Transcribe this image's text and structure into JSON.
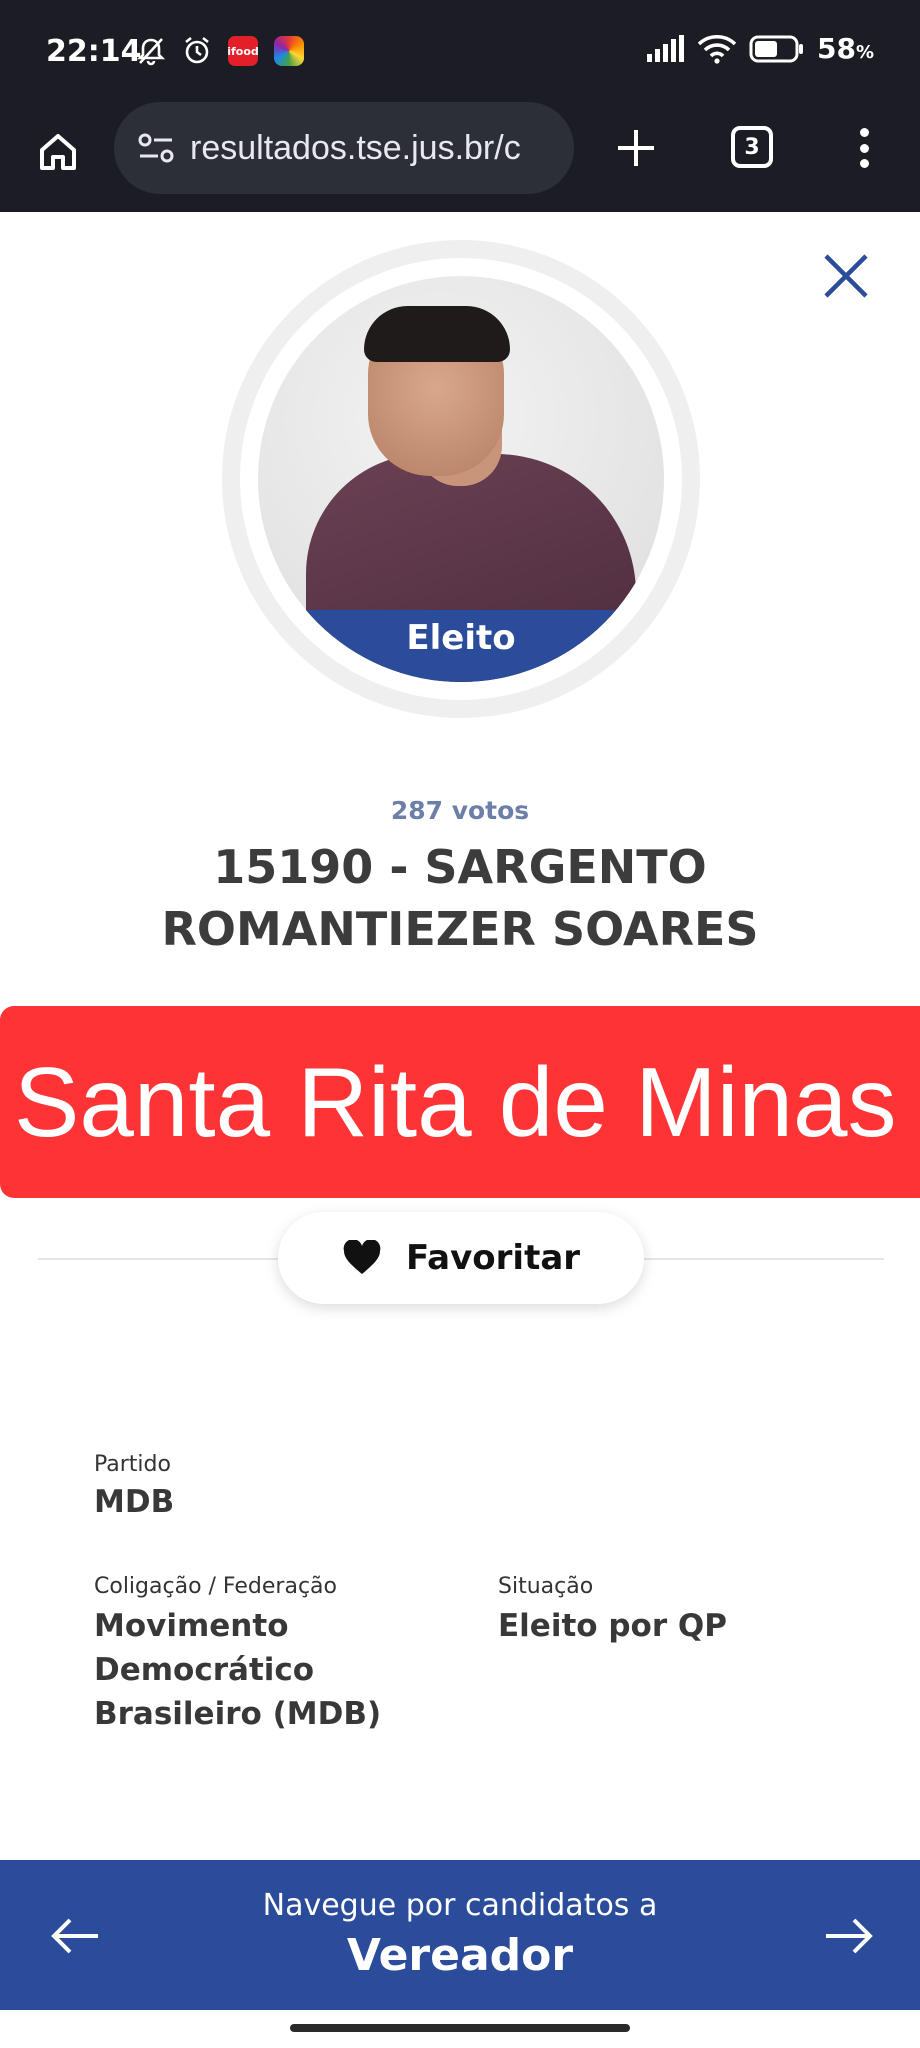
{
  "status_bar": {
    "time": "22:14",
    "left_icons": [
      "notifications-muted-icon",
      "alarm-icon",
      "ifood-app-icon",
      "colorful-app-icon"
    ],
    "ifood_text": "ifood",
    "right_icons": [
      "signal-icon",
      "wifi-icon",
      "battery-icon"
    ],
    "battery_percent": "58",
    "battery_unit": "%",
    "battery_level": 0.58
  },
  "browser": {
    "url": "resultados.tse.jus.br/c",
    "tab_count": "3",
    "icons": [
      "home-icon",
      "site-settings-icon",
      "new-tab-icon",
      "tabs-icon",
      "more-menu-icon"
    ]
  },
  "candidate": {
    "status_badge": "Eleito",
    "votes": "287 votos",
    "name_line1": "15190 - SARGENTO",
    "name_line2": "ROMANTIEZER SOARES"
  },
  "overlay_banner": {
    "text": "Santa Rita de Minas",
    "color": "#fd3336"
  },
  "actions": {
    "favorite_label": "Favoritar"
  },
  "details": {
    "party_label": "Partido",
    "party_value": "MDB",
    "coalition_label": "Coligação / Federação",
    "coalition_value_lines": [
      "Movimento",
      "Democrático",
      "Brasileiro (MDB)"
    ],
    "situation_label": "Situação",
    "situation_value": "Eleito por QP"
  },
  "bottom_nav": {
    "subtitle": "Navegue por candidatos a",
    "title": "Vereador"
  },
  "colors": {
    "primary_blue": "#2b4c9a",
    "system_bar": "#1b1c24",
    "votes_text": "#6c7fa8"
  }
}
